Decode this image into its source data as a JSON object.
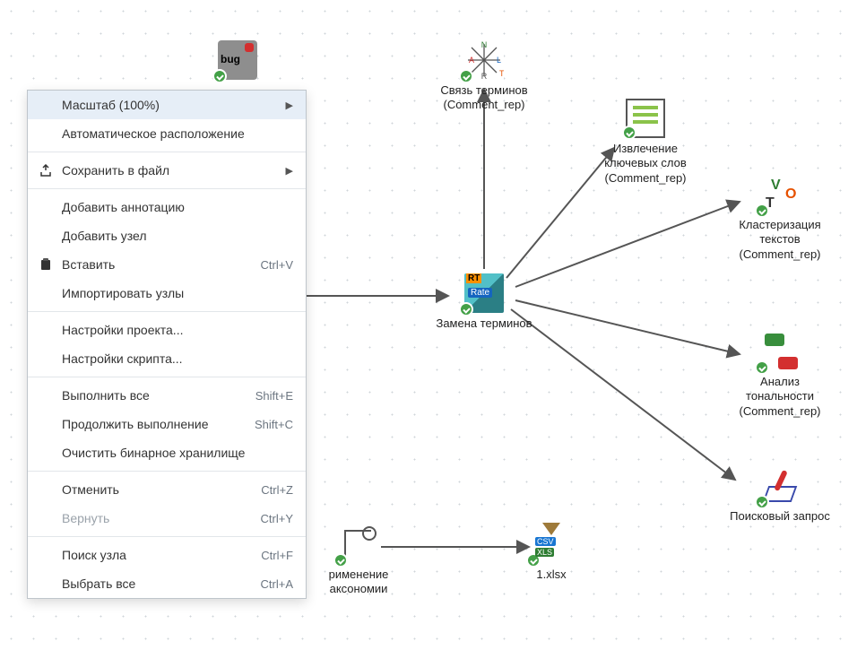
{
  "menu": {
    "items": [
      {
        "label": "Масштаб (100%)",
        "submenu": true,
        "hover": true
      },
      {
        "label": "Автоматическое расположение"
      },
      {
        "sep": true
      },
      {
        "label": "Сохранить в файл",
        "submenu": true,
        "icon": "export-icon"
      },
      {
        "sep": true
      },
      {
        "label": "Добавить аннотацию"
      },
      {
        "label": "Добавить узел"
      },
      {
        "label": "Вставить",
        "kbd": "Ctrl+V",
        "icon": "paste-icon"
      },
      {
        "label": "Импортировать узлы"
      },
      {
        "sep": true
      },
      {
        "label": "Настройки проекта..."
      },
      {
        "label": "Настройки скрипта..."
      },
      {
        "sep": true
      },
      {
        "label": "Выполнить все",
        "kbd": "Shift+E"
      },
      {
        "label": "Продолжить выполнение",
        "kbd": "Shift+C"
      },
      {
        "label": "Очистить бинарное хранилище"
      },
      {
        "sep": true
      },
      {
        "label": "Отменить",
        "kbd": "Ctrl+Z"
      },
      {
        "label": "Вернуть",
        "kbd": "Ctrl+Y",
        "disabled": true
      },
      {
        "sep": true
      },
      {
        "label": "Поиск узла",
        "kbd": "Ctrl+F"
      },
      {
        "label": "Выбрать все",
        "kbd": "Ctrl+A"
      }
    ]
  },
  "nodes": {
    "bug": {
      "label": ""
    },
    "termlink": {
      "label": "Связь терминов (Comment_rep)"
    },
    "keywords": {
      "label": "Извлечение ключевых слов (Comment_rep)"
    },
    "cluster": {
      "label": "Кластеризация текстов (Comment_rep)"
    },
    "replace": {
      "label": "Замена терминов"
    },
    "sentiment": {
      "label": "Анализ тональности (Comment_rep)"
    },
    "search": {
      "label": "Поисковый запрос"
    },
    "taxo": {
      "label": "рименение аксономии"
    },
    "csv": {
      "label": "1.xlsx"
    }
  }
}
